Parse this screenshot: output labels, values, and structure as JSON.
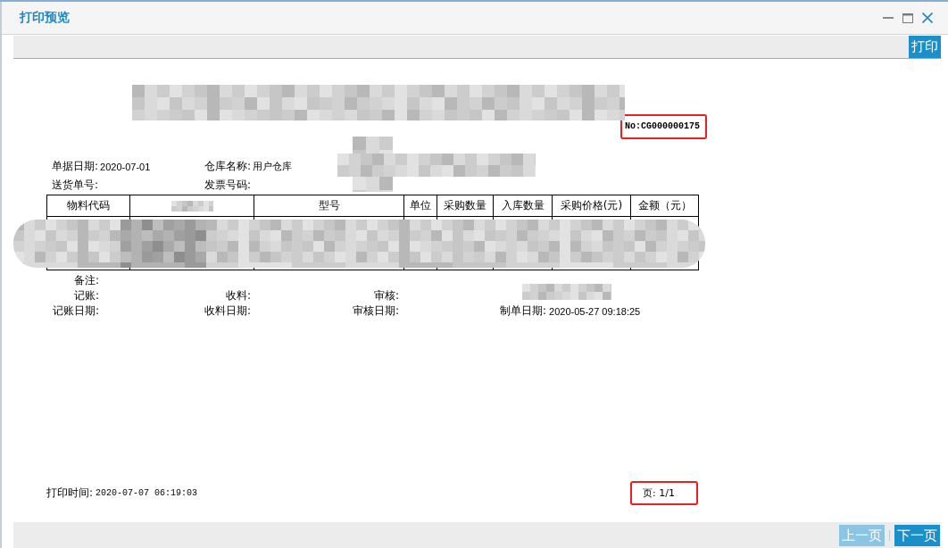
{
  "window": {
    "title": "打印预览"
  },
  "toolbar": {
    "print_button": "打印"
  },
  "document": {
    "number": {
      "text": "No:CG000000175",
      "highlighted": true
    },
    "fields": [
      [
        {
          "label": "单据日期:",
          "value": "2020-07-01"
        },
        {
          "label": "仓库名称:",
          "value": "用户仓库"
        }
      ],
      [
        {
          "label": "送货单号:"
        },
        {
          "label": "发票号码:"
        }
      ]
    ],
    "table": {
      "columns": [
        {
          "label": "物料代码",
          "obscured": false
        },
        {
          "obscured": true
        },
        {
          "label": "型号",
          "obscured": false
        },
        {
          "label": "单位",
          "obscured": false
        },
        {
          "label": "采购数量",
          "obscured": false
        },
        {
          "label": "入库数量",
          "obscured": false
        },
        {
          "label": "采购价格(元)",
          "obscured": false
        },
        {
          "label": "金额（元）",
          "obscured": false
        }
      ]
    },
    "signatures": [
      [
        {
          "label": "备注:"
        }
      ],
      [
        {
          "label": "记账:"
        },
        {
          "label": "收料:"
        },
        {
          "label": "审核:"
        }
      ],
      [
        {
          "label": "记账日期:"
        },
        {
          "label": "收料日期:"
        },
        {
          "label": "审核日期:"
        },
        {
          "label": "制单日期:",
          "value": "2020-05-27 09:18:25"
        }
      ]
    ],
    "print_time": {
      "label": "打印时间:",
      "value": "2020-07-07 06:19:03"
    },
    "page": {
      "text": "页: 1/1",
      "highlighted": true
    }
  },
  "pager": [
    {
      "label": "上一页",
      "disabled": true
    },
    {
      "label": "下一页",
      "disabled": false
    }
  ]
}
